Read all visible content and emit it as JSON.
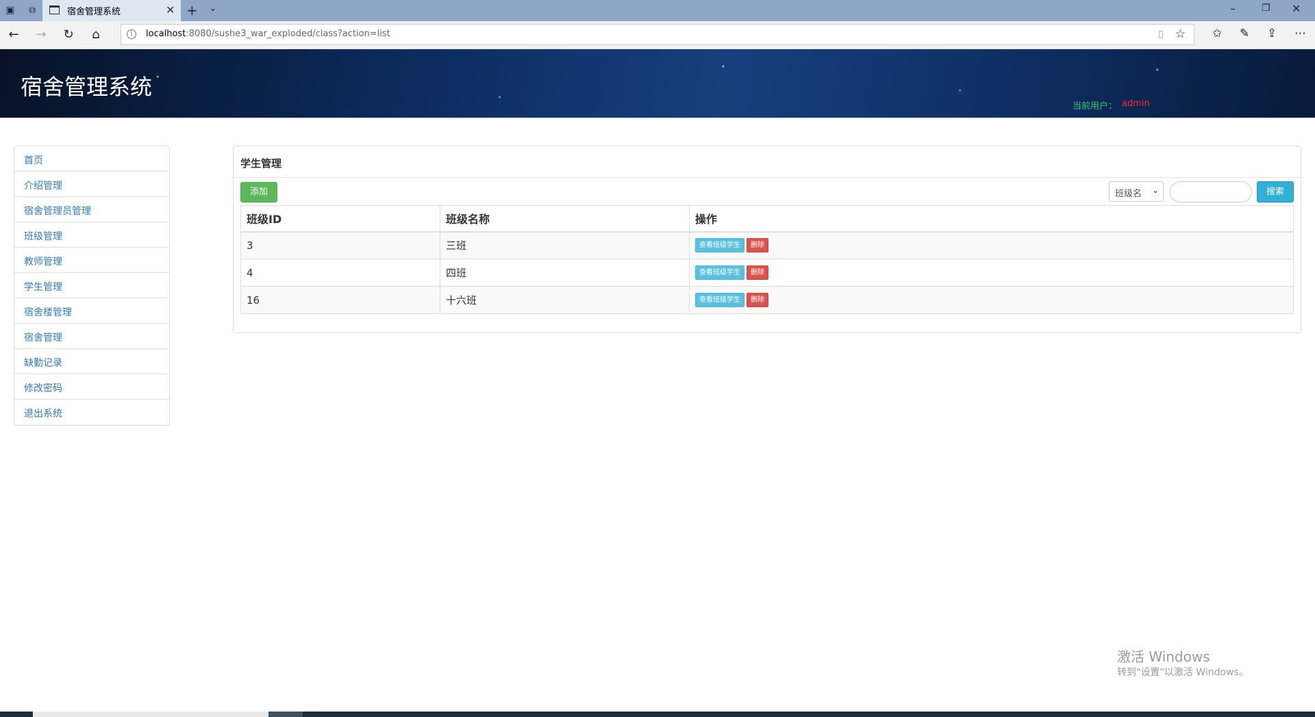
{
  "browser": {
    "tab_title": "宿舍管理系统",
    "url_host": "localhost",
    "url_rest": ":8080/sushe3_war_exploded/class?action=list"
  },
  "header": {
    "site_title": "宿舍管理系统",
    "current_user_label": "当前用户：",
    "current_user": "admin"
  },
  "sidebar": {
    "items": [
      {
        "label": "首页"
      },
      {
        "label": "介绍管理"
      },
      {
        "label": "宿舍管理员管理"
      },
      {
        "label": "班级管理"
      },
      {
        "label": "教师管理"
      },
      {
        "label": "学生管理"
      },
      {
        "label": "宿舍楼管理"
      },
      {
        "label": "宿舍管理"
      },
      {
        "label": "缺勤记录"
      },
      {
        "label": "修改密码"
      },
      {
        "label": "退出系统"
      }
    ]
  },
  "main": {
    "panel_title": "学生管理",
    "add_label": "添加",
    "search_select_value": "班级名",
    "search_label": "搜索",
    "columns": [
      "班级ID",
      "班级名称",
      "操作"
    ],
    "rows": [
      {
        "id": "3",
        "name": "三班",
        "view_label": "查看班级学生",
        "delete_label": "删除"
      },
      {
        "id": "4",
        "name": "四班",
        "view_label": "查看班级学生",
        "delete_label": "删除"
      },
      {
        "id": "16",
        "name": "十六班",
        "view_label": "查看班级学生",
        "delete_label": "删除"
      }
    ]
  },
  "watermark": {
    "title": "激活 Windows",
    "subtitle": "转到\"设置\"以激活 Windows。"
  },
  "colors": {
    "accent_link": "#337ab7",
    "add_button": "#5cb85c",
    "search_button": "#31b0d5",
    "delete_button": "#d9534f",
    "user_label": "#2ecc71",
    "user_name": "#ff2a2a"
  },
  "icons": [
    "tab-preview-icon",
    "set-tabs-aside-icon",
    "page-icon",
    "close-icon",
    "new-tab-icon",
    "chevron-down-icon",
    "minimize-icon",
    "restore-icon",
    "back-icon",
    "forward-icon",
    "refresh-icon",
    "home-icon",
    "info-icon",
    "reading-view-icon",
    "favorite-star-icon",
    "favorites-icon",
    "pen-icon",
    "share-icon",
    "more-icon"
  ]
}
